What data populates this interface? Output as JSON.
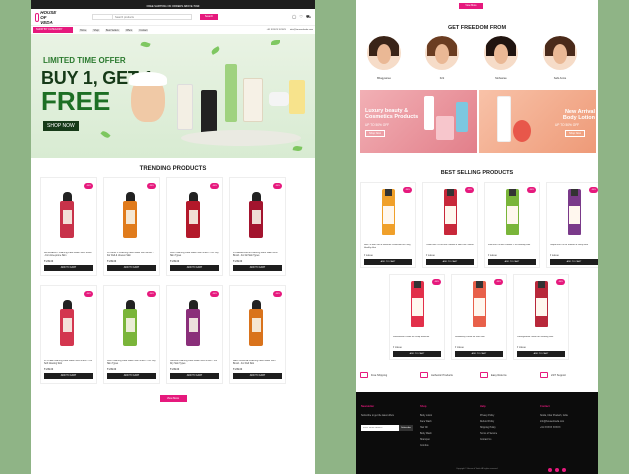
{
  "left_page": {
    "announcement": "FREE SHIPPING ON ORDERS ABOVE ₹499",
    "logo_text": "HOUSE OF VEDA",
    "search": {
      "placeholder": "Search products",
      "button": "Search"
    },
    "nav": {
      "categories_label": "SHOP BY CATEGORY",
      "links": [
        "Home",
        "Shop",
        "Best Sellers",
        "Offers",
        "Contact"
      ],
      "phone": "+91 XXXXX XXXXX",
      "email": "info@houseofveda.com"
    },
    "hero": {
      "subtitle": "LIMITED TIME OFFER",
      "headline": "BUY 1, GET 1",
      "emphasis": "FREE",
      "cta": "SHOP NOW"
    },
    "trending": {
      "title": "TRENDING PRODUCTS",
      "view_more": "View More",
      "add_to_cart": "ADD TO CART",
      "products": [
        {
          "name": "RASPBERRY Foaming Face Wash With Brush - For Acne-prone Skin",
          "price": "₹ 249.00",
          "discount": "-50%",
          "color": "#c8324a"
        },
        {
          "name": "VITAMIN C Foaming Face Wash With Brush - For Dull & Uneven Skin",
          "price": "₹ 249.00",
          "discount": "-50%",
          "color": "#e07b1c"
        },
        {
          "name": "KIWI Foaming Face Wash With Brush - For Oily Skin Types",
          "price": "₹ 249.00",
          "discount": "-50%",
          "color": "#b3182a"
        },
        {
          "name": "POMEGRANATE Foaming Face Wash With Brush - For All Skin Types",
          "price": "₹ 249.00",
          "discount": "-50%",
          "color": "#a3142e"
        },
        {
          "name": "LYCHEE Foaming Face Wash With Brush - For Soft Glowing Skin",
          "price": "₹ 249.00",
          "discount": "-50%",
          "color": "#d3364f"
        },
        {
          "name": "KIWI Foaming Face Wash With Brush - For Oily Skin Types",
          "price": "₹ 249.00",
          "discount": "-50%",
          "color": "#7ab53a"
        },
        {
          "name": "GRAPE Foaming Face Wash With Brush - For Dry Skin Types",
          "price": "₹ 249.00",
          "discount": "-50%",
          "color": "#8a2f7a"
        },
        {
          "name": "RED ORANGE Foaming Face Wash With Brush - For Dull Skin",
          "price": "₹ 249.00",
          "discount": "-50%",
          "color": "#d9731c"
        }
      ]
    }
  },
  "right_page": {
    "view_more_top": "View More",
    "influencers": {
      "title": "GET FREEDOM FROM",
      "people": [
        {
          "name": "Bhagyasree",
          "hair": "#3a2418"
        },
        {
          "name": "Kriti",
          "hair": "#6b3d22"
        },
        {
          "name": "Mohasree",
          "hair": "#201410"
        },
        {
          "name": "Sabi Annie",
          "hair": "#4a2a1a"
        }
      ]
    },
    "promos": [
      {
        "title": "Luxury beauty & Cosmetics Products",
        "sub": "UP TO 50% OFF",
        "button": "Shop Now",
        "bg": "#e89aa2"
      },
      {
        "title": "New Arrival Body Lotion",
        "sub": "UP TO 50% OFF",
        "button": "Shop Now",
        "bg": "#f1a98c"
      }
    ],
    "best_selling": {
      "title": "BEST SELLING PRODUCTS",
      "add_to_cart": "ADD TO CART",
      "products": [
        {
          "name": "Hair Oil with Sun & Moisture Protection for Long Healthy Hair",
          "price": "₹ 349.00",
          "discount": "-50%",
          "color": "#f0a02a"
        },
        {
          "name": "Onion Hair Oil for Hair Growth & Hair Fall Control",
          "price": "₹ 349.00",
          "discount": "-50%",
          "color": "#c8283a"
        },
        {
          "name": "Kiwi Hair Oil with Vitamin C for Healthy Hair",
          "price": "₹ 349.00",
          "discount": "-50%",
          "color": "#7ab53a"
        },
        {
          "name": "Grape Hair Oil for Smooth & Shiny Hair",
          "price": "₹ 349.00",
          "discount": "-50%",
          "color": "#7a3a8a"
        },
        {
          "name": "Watermelon Lotion for Deep Moisture",
          "price": "₹ 299.00",
          "discount": "-50%",
          "color": "#e2304a"
        },
        {
          "name": "Strawberry Lotion for Soft Skin",
          "price": "₹ 299.00",
          "discount": "-50%",
          "color": "#e8604a"
        },
        {
          "name": "Pomegranate Lotion for Glowing Skin",
          "price": "₹ 299.00",
          "discount": "-50%",
          "color": "#b8283a"
        }
      ]
    },
    "features": [
      "Free Shipping",
      "Authentic Products",
      "Easy Returns",
      "24/7 Support"
    ],
    "footer": {
      "col1_title": "Newsletter",
      "col1_text": "Subscribe to get the latest offers",
      "email_placeholder": "Enter email address",
      "subscribe": "Subscribe",
      "col2_title": "Shop",
      "col2_links": [
        "Body Lotion",
        "Face Wash",
        "Hair Oil",
        "Body Wash",
        "Shampoo",
        "Combos"
      ],
      "col3_title": "Help",
      "col3_links": [
        "Privacy Policy",
        "Refund Policy",
        "Shipping Policy",
        "Terms of Service",
        "Contact Us"
      ],
      "col4_title": "Contact",
      "address": "Noida, Uttar Pradesh, India",
      "email": "info@houseofveda.com",
      "phone": "+91 XXXXX XXXXX",
      "copyright": "Copyright © House of Veda. All rights reserved."
    }
  }
}
